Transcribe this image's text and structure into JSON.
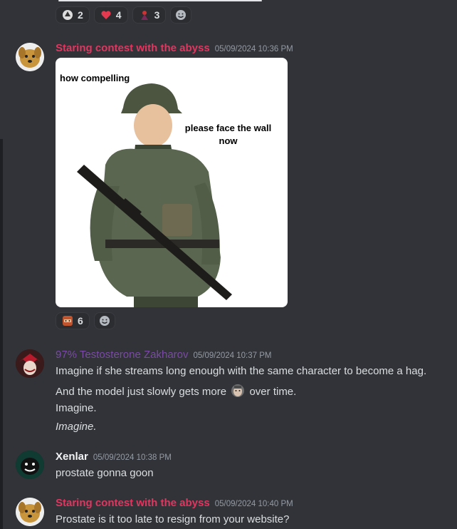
{
  "colors": {
    "background": "#313338",
    "user_pink": "#e0365f",
    "user_purple": "#7b4aa6",
    "user_white": "#f2f3f5",
    "timestamp": "#949ba4",
    "text": "#dbdee1"
  },
  "top_reactions": [
    {
      "icon": "character-emoji",
      "count": "2"
    },
    {
      "icon": "red-heart-emoji",
      "count": "4"
    },
    {
      "icon": "character-emoji",
      "count": "3"
    }
  ],
  "messages": [
    {
      "author": "Staring contest with the abyss",
      "timestamp": "05/09/2024 10:36 PM",
      "attachment": {
        "caption_top_left": "how compelling",
        "caption_right": "please face the wall now"
      },
      "reactions": [
        {
          "icon": "face-emoji",
          "count": "6"
        }
      ]
    },
    {
      "author": "97% Testosterone Zakharov",
      "timestamp": "05/09/2024 10:37 PM",
      "lines": [
        "Imagine if she streams long enough with the same character to become a hag.",
        "And the model just slowly gets more",
        "over time.",
        "Imagine.",
        "Imagine."
      ]
    },
    {
      "author": "Xenlar",
      "timestamp": "05/09/2024 10:38 PM",
      "lines": [
        "prostate gonna goon"
      ]
    },
    {
      "author": "Staring contest with the abyss",
      "timestamp": "05/09/2024 10:40 PM",
      "lines": [
        "Prostate is it too late to resign from your website?"
      ]
    }
  ]
}
